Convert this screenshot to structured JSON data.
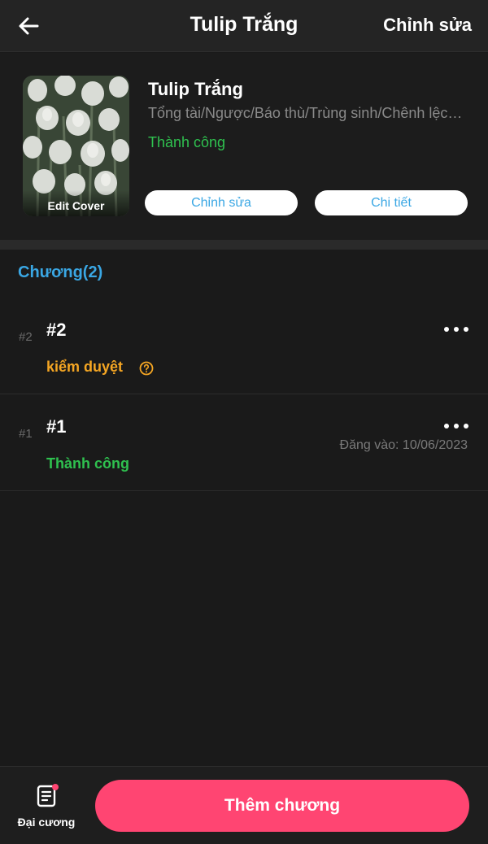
{
  "header": {
    "title": "Tulip Trắng",
    "edit_label": "Chỉnh sửa"
  },
  "book": {
    "title": "Tulip Trắng",
    "tags": "Tổng tài/Ngược/Báo thù/Trùng sinh/Chênh lệch tuổi tác",
    "status": "Thành công",
    "cover_label": "Edit Cover",
    "edit_button": "Chỉnh sửa",
    "detail_button": "Chi tiết"
  },
  "chapters": {
    "heading": "Chương(2)",
    "items": [
      {
        "index": "#2",
        "title": "#2",
        "status": "kiểm duyệt",
        "date": ""
      },
      {
        "index": "#1",
        "title": "#1",
        "status": "Thành công",
        "date": "Đăng vào: 10/06/2023"
      }
    ]
  },
  "bottom": {
    "outline_label": "Đại cương",
    "add_chapter_label": "Thêm chương"
  },
  "colors": {
    "accent_blue": "#3aa7e4",
    "success_green": "#2fc14f",
    "review_orange": "#f5a623",
    "primary_pink": "#ff4572",
    "background": "#1a1a1a"
  },
  "icons": {
    "back": "arrow-left-icon",
    "more": "more-horizontal-icon",
    "help": "question-circle-icon",
    "outline": "document-list-icon"
  }
}
